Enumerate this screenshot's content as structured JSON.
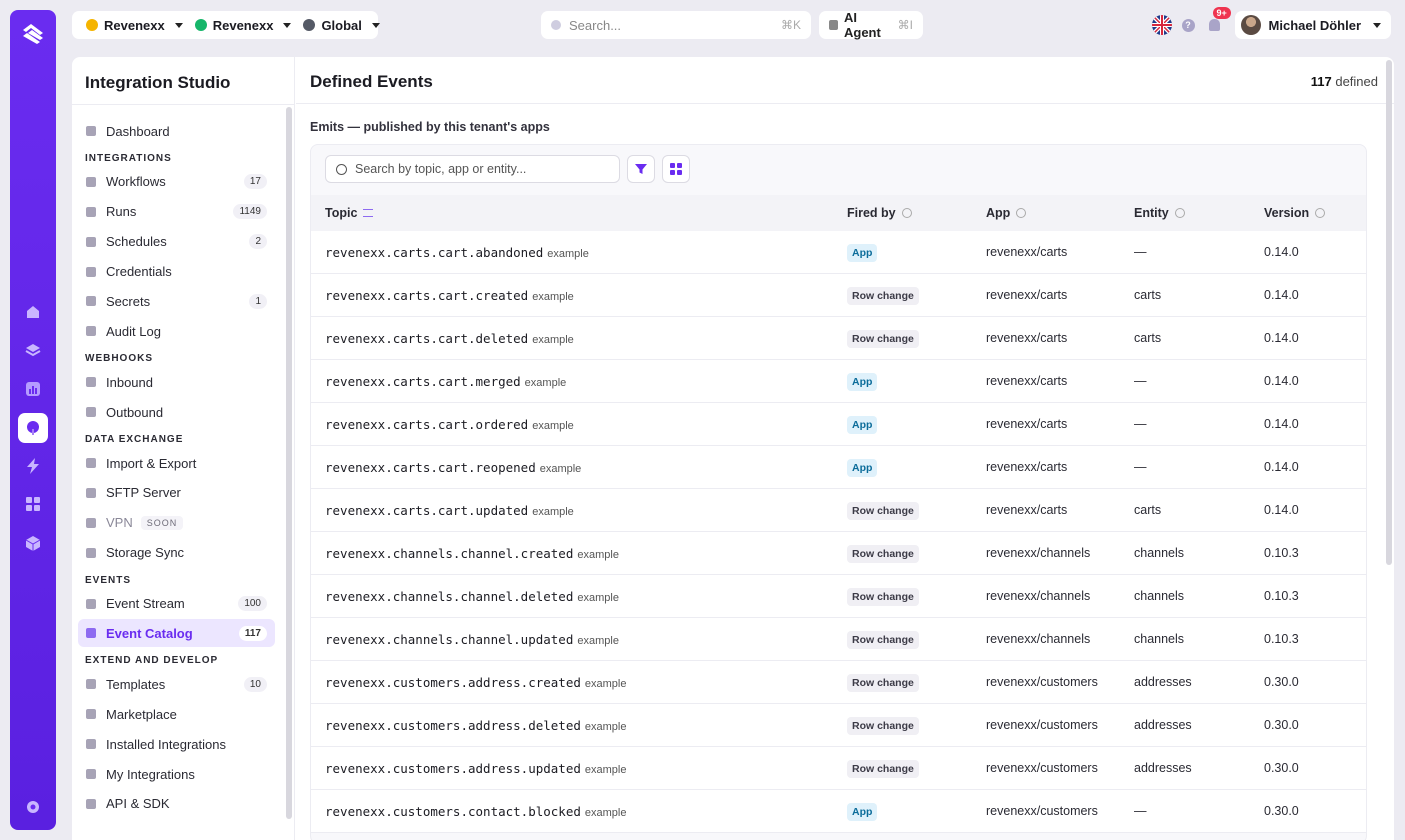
{
  "topbar": {
    "tenant1": "Revenexx",
    "tenant2": "Revenexx",
    "region": "Global",
    "search_placeholder": "Search...",
    "search_kbd": "⌘K",
    "ai_label": "AI Agent",
    "ai_kbd": "⌘I",
    "notif_count": "9+",
    "help": "?",
    "user_name": "Michael Döhler"
  },
  "colors": {
    "accent": "#6a2cf0",
    "tenant1_dot": "#f5b400",
    "tenant2_dot": "#16b66a"
  },
  "sidebar": {
    "title": "Integration Studio",
    "dashboard": "Dashboard",
    "sections": {
      "integrations": "INTEGRATIONS",
      "webhooks": "WEBHOOKS",
      "data_exchange": "DATA EXCHANGE",
      "events": "EVENTS",
      "extend": "EXTEND AND DEVELOP"
    },
    "items": {
      "workflows": {
        "label": "Workflows",
        "count": "17"
      },
      "runs": {
        "label": "Runs",
        "count": "1149"
      },
      "schedules": {
        "label": "Schedules",
        "count": "2"
      },
      "credentials": {
        "label": "Credentials"
      },
      "secrets": {
        "label": "Secrets",
        "count": "1"
      },
      "audit": {
        "label": "Audit Log"
      },
      "inbound": {
        "label": "Inbound"
      },
      "outbound": {
        "label": "Outbound"
      },
      "import": {
        "label": "Import & Export"
      },
      "sftp": {
        "label": "SFTP Server"
      },
      "vpn": {
        "label": "VPN",
        "tag": "SOON"
      },
      "storage": {
        "label": "Storage Sync"
      },
      "stream": {
        "label": "Event Stream",
        "count": "100"
      },
      "catalog": {
        "label": "Event Catalog",
        "count": "117"
      },
      "templates": {
        "label": "Templates",
        "count": "10"
      },
      "marketplace": {
        "label": "Marketplace"
      },
      "installed": {
        "label": "Installed Integrations"
      },
      "mine": {
        "label": "My Integrations"
      },
      "api": {
        "label": "API & SDK"
      }
    }
  },
  "content": {
    "title": "Defined Events",
    "defined_count": "117",
    "defined_label": "defined",
    "emits_label": "Emits — published by this tenant's apps",
    "table_search_placeholder": "Search by topic, app or entity...",
    "columns": {
      "topic": "Topic",
      "fired_by": "Fired by",
      "app": "App",
      "entity": "Entity",
      "version": "Version"
    },
    "example_label": "example",
    "rows": [
      {
        "topic": "revenexx.carts.cart.abandoned",
        "fired_by": "App",
        "app": "revenexx/carts",
        "entity": "—",
        "version": "0.14.0"
      },
      {
        "topic": "revenexx.carts.cart.created",
        "fired_by": "Row change",
        "app": "revenexx/carts",
        "entity": "carts",
        "version": "0.14.0"
      },
      {
        "topic": "revenexx.carts.cart.deleted",
        "fired_by": "Row change",
        "app": "revenexx/carts",
        "entity": "carts",
        "version": "0.14.0"
      },
      {
        "topic": "revenexx.carts.cart.merged",
        "fired_by": "App",
        "app": "revenexx/carts",
        "entity": "—",
        "version": "0.14.0"
      },
      {
        "topic": "revenexx.carts.cart.ordered",
        "fired_by": "App",
        "app": "revenexx/carts",
        "entity": "—",
        "version": "0.14.0"
      },
      {
        "topic": "revenexx.carts.cart.reopened",
        "fired_by": "App",
        "app": "revenexx/carts",
        "entity": "—",
        "version": "0.14.0"
      },
      {
        "topic": "revenexx.carts.cart.updated",
        "fired_by": "Row change",
        "app": "revenexx/carts",
        "entity": "carts",
        "version": "0.14.0"
      },
      {
        "topic": "revenexx.channels.channel.created",
        "fired_by": "Row change",
        "app": "revenexx/channels",
        "entity": "channels",
        "version": "0.10.3"
      },
      {
        "topic": "revenexx.channels.channel.deleted",
        "fired_by": "Row change",
        "app": "revenexx/channels",
        "entity": "channels",
        "version": "0.10.3"
      },
      {
        "topic": "revenexx.channels.channel.updated",
        "fired_by": "Row change",
        "app": "revenexx/channels",
        "entity": "channels",
        "version": "0.10.3"
      },
      {
        "topic": "revenexx.customers.address.created",
        "fired_by": "Row change",
        "app": "revenexx/customers",
        "entity": "addresses",
        "version": "0.30.0"
      },
      {
        "topic": "revenexx.customers.address.deleted",
        "fired_by": "Row change",
        "app": "revenexx/customers",
        "entity": "addresses",
        "version": "0.30.0"
      },
      {
        "topic": "revenexx.customers.address.updated",
        "fired_by": "Row change",
        "app": "revenexx/customers",
        "entity": "addresses",
        "version": "0.30.0"
      },
      {
        "topic": "revenexx.customers.contact.blocked",
        "fired_by": "App",
        "app": "revenexx/customers",
        "entity": "—",
        "version": "0.30.0"
      }
    ]
  }
}
